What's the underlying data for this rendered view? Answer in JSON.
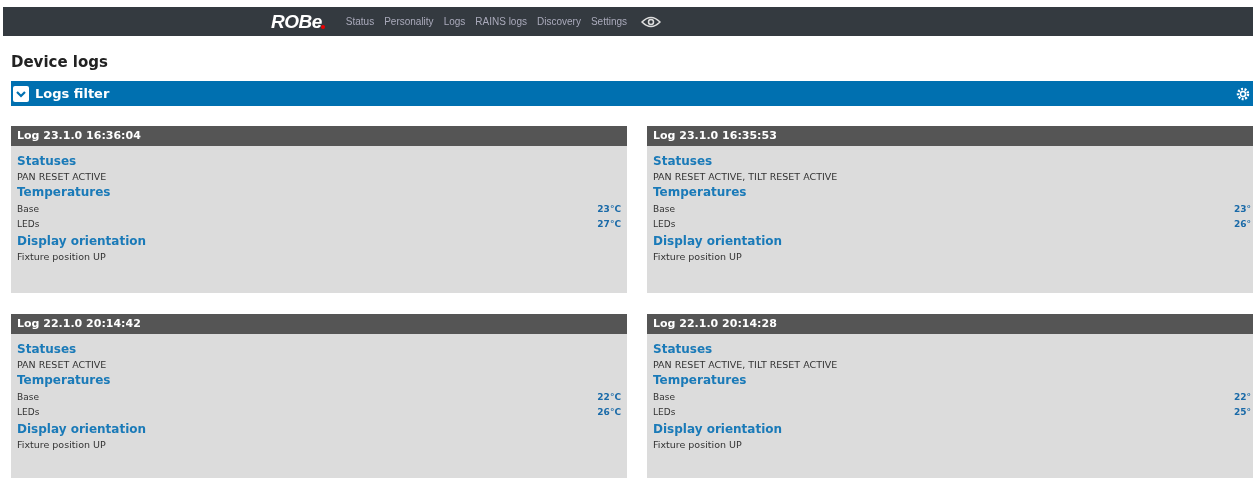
{
  "navbar": {
    "logo": "ROBe",
    "items": [
      {
        "label": "Status",
        "selected": false
      },
      {
        "label": "Personality",
        "selected": false
      },
      {
        "label": "Logs",
        "selected": false
      },
      {
        "label": "RAINS logs",
        "selected": false
      },
      {
        "label": "Discovery",
        "selected": false
      },
      {
        "label": "Settings",
        "selected": false
      }
    ]
  },
  "page_title": "Device logs",
  "filter": {
    "label": "Logs filter",
    "expanded": false
  },
  "logs": [
    {
      "title": "Log 23.1.0 16:36:04",
      "statuses_heading": "Statuses",
      "status": "PAN RESET ACTIVE",
      "temperatures_heading": "Temperatures",
      "temperatures": [
        {
          "name": "Base",
          "value": "23°C"
        },
        {
          "name": "LEDs",
          "value": "27°C"
        }
      ],
      "orientation_heading": "Display orientation",
      "orientation": "Fixture position UP"
    },
    {
      "title": "Log 23.1.0 16:35:53",
      "statuses_heading": "Statuses",
      "status": "PAN RESET ACTIVE, TILT RESET ACTIVE",
      "temperatures_heading": "Temperatures",
      "temperatures": [
        {
          "name": "Base",
          "value": "23°"
        },
        {
          "name": "LEDs",
          "value": "26°"
        }
      ],
      "orientation_heading": "Display orientation",
      "orientation": "Fixture position UP"
    },
    {
      "title": "Log 22.1.0 20:14:42",
      "statuses_heading": "Statuses",
      "status": "PAN RESET ACTIVE",
      "temperatures_heading": "Temperatures",
      "temperatures": [
        {
          "name": "Base",
          "value": "22°C"
        },
        {
          "name": "LEDs",
          "value": "26°C"
        }
      ],
      "orientation_heading": "Display orientation",
      "orientation": "Fixture position UP"
    },
    {
      "title": "Log 22.1.0 20:14:28",
      "statuses_heading": "Statuses",
      "status": "PAN RESET ACTIVE, TILT RESET ACTIVE",
      "temperatures_heading": "Temperatures",
      "temperatures": [
        {
          "name": "Base",
          "value": "22°"
        },
        {
          "name": "LEDs",
          "value": "25°"
        }
      ],
      "orientation_heading": "Display orientation",
      "orientation": "Fixture position UP"
    }
  ]
}
